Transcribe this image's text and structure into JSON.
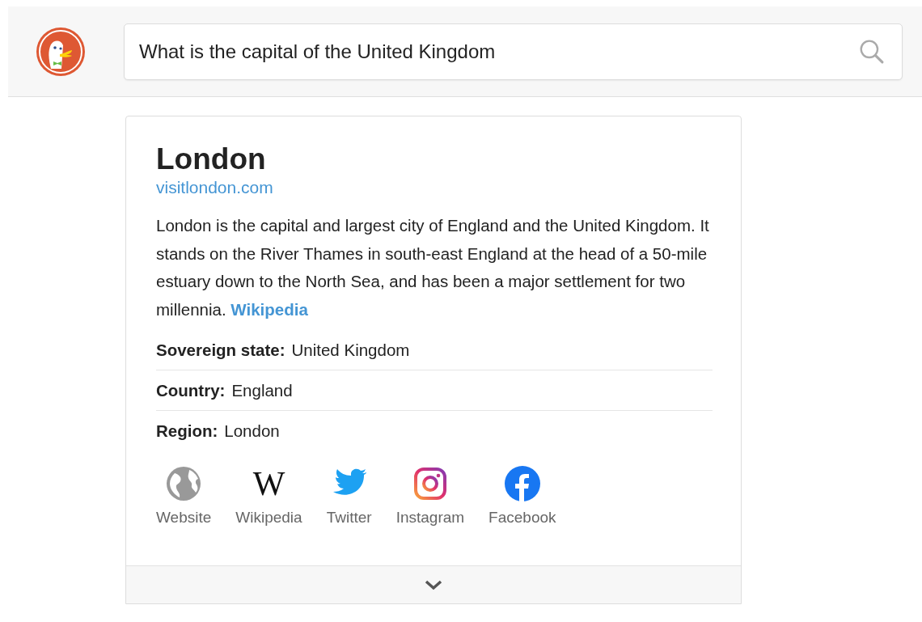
{
  "search": {
    "value": "What is the capital of the United Kingdom"
  },
  "card": {
    "title": "London",
    "url": "visitlondon.com",
    "abstract": "London is the capital and largest city of England and the United Kingdom. It stands on the River Thames in south-east England at the head of a 50-mile estuary down to the North Sea, and has been a major settlement for two millennia.",
    "source": "Wikipedia",
    "facts": [
      {
        "label": "Sovereign state:",
        "value": "United Kingdom"
      },
      {
        "label": "Country:",
        "value": "England"
      },
      {
        "label": "Region:",
        "value": "London"
      }
    ],
    "profiles": [
      {
        "kind": "globe",
        "label": "Website"
      },
      {
        "kind": "letter",
        "glyph": "W",
        "label": "Wikipedia"
      },
      {
        "kind": "bird",
        "label": "Twitter"
      },
      {
        "kind": "camera",
        "label": "Instagram"
      },
      {
        "kind": "facebook",
        "label": "Facebook"
      }
    ]
  }
}
